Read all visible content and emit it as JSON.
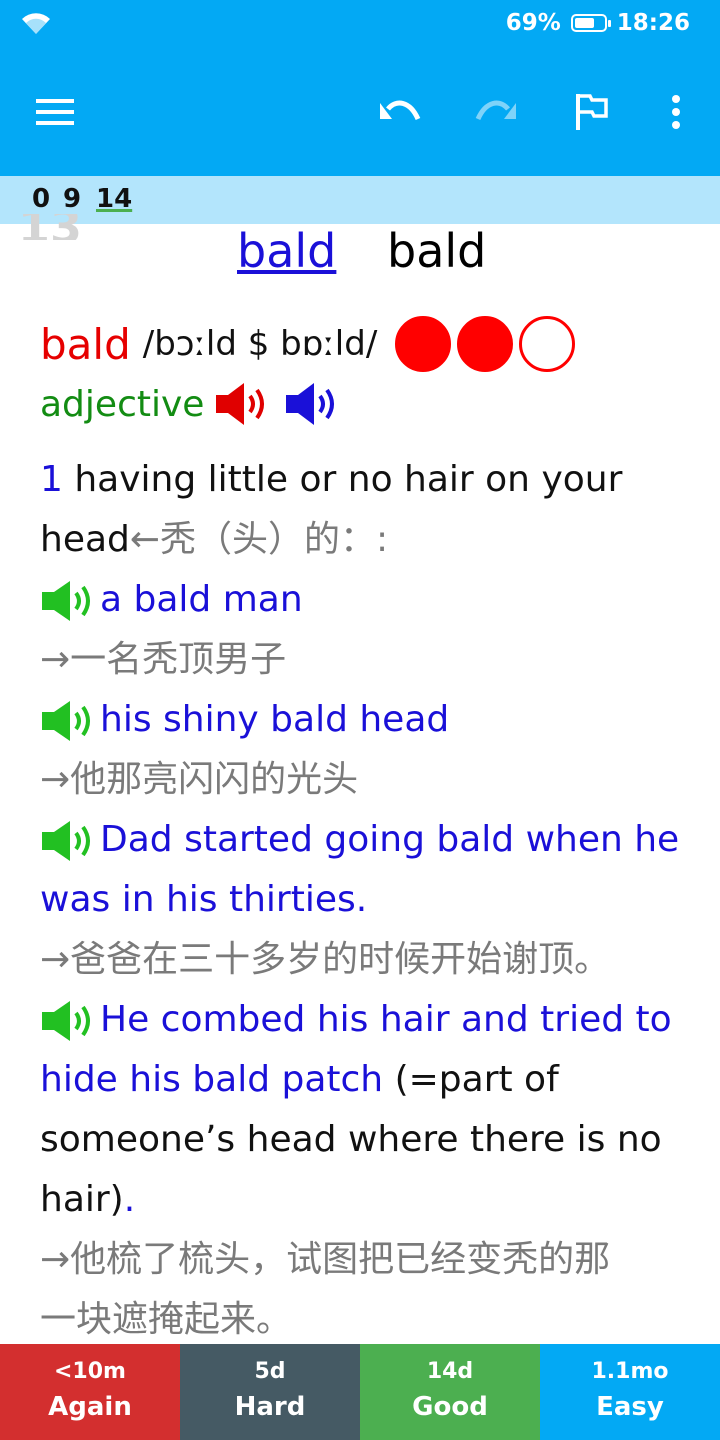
{
  "status_bar": {
    "battery": "69%",
    "battery_level": 0.69,
    "time": "18:26"
  },
  "toolbar": {
    "icons": [
      "menu-icon",
      "undo-icon",
      "redo-icon",
      "flag-icon",
      "more-vert-icon"
    ]
  },
  "counts": {
    "new": "0",
    "review": "9",
    "learn": "14"
  },
  "ghost_text": "13",
  "card": {
    "word_link": "bald",
    "word_plain": "bald",
    "headword": "bald",
    "pronunciation": "/bɔːld $ bɒːld/",
    "frequency_dots": {
      "filled": 2,
      "total": 3
    },
    "part_of_speech": "adjective",
    "sense_number": "1",
    "definition_1": "having little or no hair on your",
    "definition_2": "head",
    "definition_zh": "←秃（头）的：:",
    "examples": {
      "ex1": "a bald man",
      "ex1_zh": "→一名秃顶男子",
      "ex2": "his shiny bald head",
      "ex2_zh": "→他那亮闪闪的光头",
      "ex3_l1": "Dad started going bald when he",
      "ex3_l2": "was in his thirties.",
      "ex3_zh": "→爸爸在三十多岁的时候开始谢顶。",
      "ex4_l1": "He combed his hair and tried to",
      "ex4_l2a": "hide his bald patch",
      "ex4_l2b": " (=part of",
      "ex4_l3": "someone’s head where there is no",
      "ex4_l4a": "hair)",
      "ex4_l4b": ".",
      "ex4_zh_l1": "→他梳了梳头，试图把已经变秃的那",
      "ex4_zh_l2": "一块遮掩起来。"
    }
  },
  "answers": [
    {
      "interval": "<10m",
      "label": "Again",
      "color": "#d32f2f"
    },
    {
      "interval": "5d",
      "label": "Hard",
      "color": "#455a64"
    },
    {
      "interval": "14d",
      "label": "Good",
      "color": "#4caf50"
    },
    {
      "interval": "1.1mo",
      "label": "Easy",
      "color": "#03a9f4"
    }
  ]
}
